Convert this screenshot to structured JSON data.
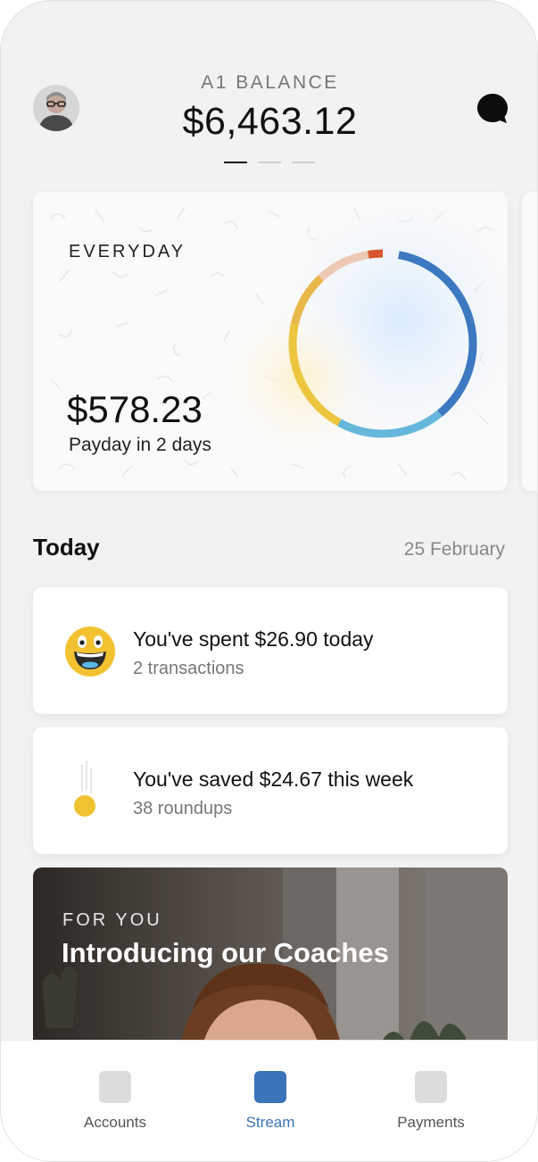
{
  "header": {
    "label": "A1 BALANCE",
    "amount": "$6,463.12",
    "pager_count": 3,
    "pager_active_index": 0
  },
  "account_card": {
    "label": "EVERYDAY",
    "amount": "$578.23",
    "subtitle": "Payday in 2 days",
    "ring_colors": [
      "#3c79c0",
      "#66b7dc",
      "#ecc63f",
      "#e9b84a",
      "#edc9b4",
      "#d8562f"
    ]
  },
  "today": {
    "title": "Today",
    "date": "25 February"
  },
  "tiles": [
    {
      "icon": "grinning-face-icon",
      "title": "You've spent $26.90 today",
      "subtitle": "2 transactions"
    },
    {
      "icon": "falling-coin-icon",
      "title": "You've saved $24.67 this week",
      "subtitle": "38 roundups"
    }
  ],
  "promo": {
    "kicker": "FOR YOU",
    "title": "Introducing our Coaches"
  },
  "tabbar": {
    "items": [
      {
        "label": "Accounts",
        "icon": "accounts-icon"
      },
      {
        "label": "Stream",
        "icon": "stream-icon"
      },
      {
        "label": "Payments",
        "icon": "payments-icon"
      }
    ],
    "active": "Stream",
    "accent_color": "#3b74b8"
  }
}
